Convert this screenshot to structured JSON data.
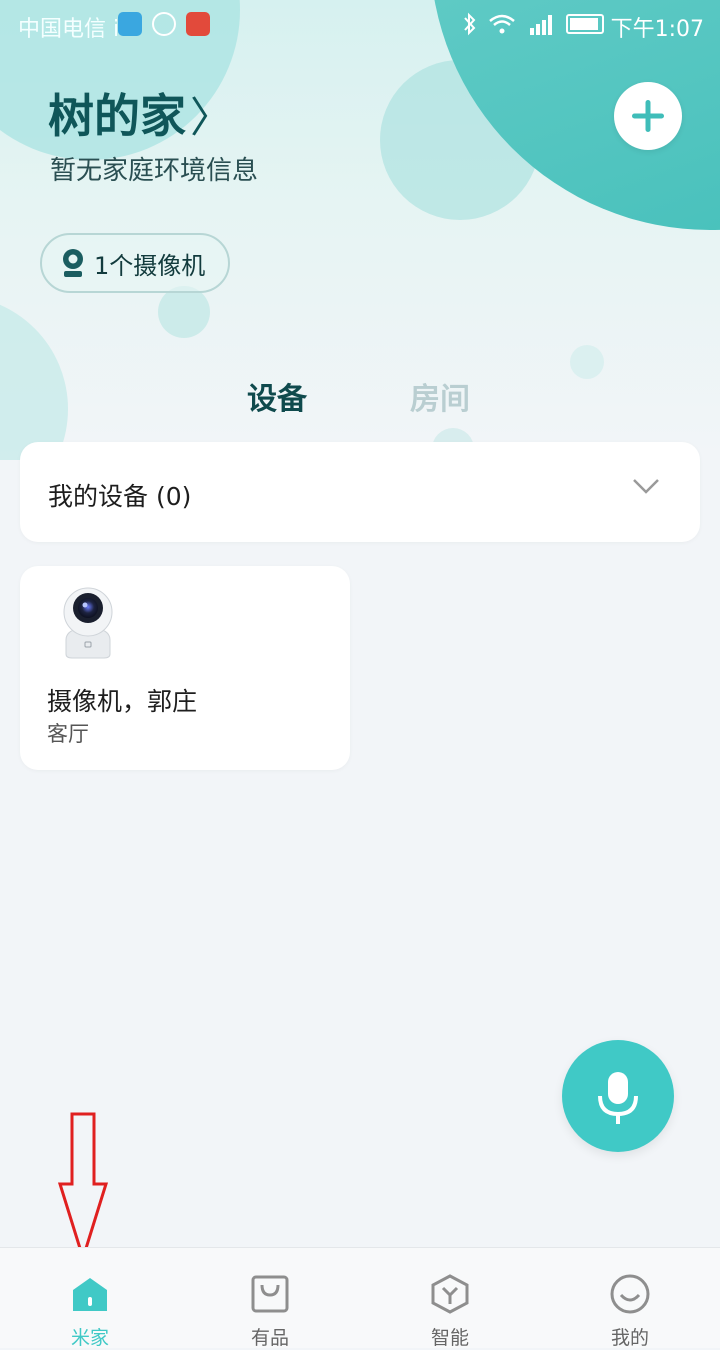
{
  "status_bar": {
    "carrier": "中国电信 ⅰ",
    "time": "下午1:07"
  },
  "home": {
    "title": "树的家",
    "title_chevron": "〉",
    "subtitle": "暂无家庭环境信息"
  },
  "camera_chip": {
    "label": "1个摄像机"
  },
  "tabs": [
    {
      "label": "设备",
      "active": true
    },
    {
      "label": "房间",
      "active": false
    }
  ],
  "my_devices": {
    "label": "我的设备 (0)"
  },
  "device": {
    "name": "摄像机，郭庄",
    "room": "客厅"
  },
  "bottom_nav": [
    {
      "label": "米家",
      "active": true,
      "icon": "home-icon"
    },
    {
      "label": "有品",
      "active": false,
      "icon": "shopping-bag-icon"
    },
    {
      "label": "智能",
      "active": false,
      "icon": "smart-cube-icon"
    },
    {
      "label": "我的",
      "active": false,
      "icon": "smile-icon"
    }
  ],
  "colors": {
    "accent": "#40c9c6",
    "title": "#0f5659",
    "annotation_arrow": "#e02020"
  }
}
